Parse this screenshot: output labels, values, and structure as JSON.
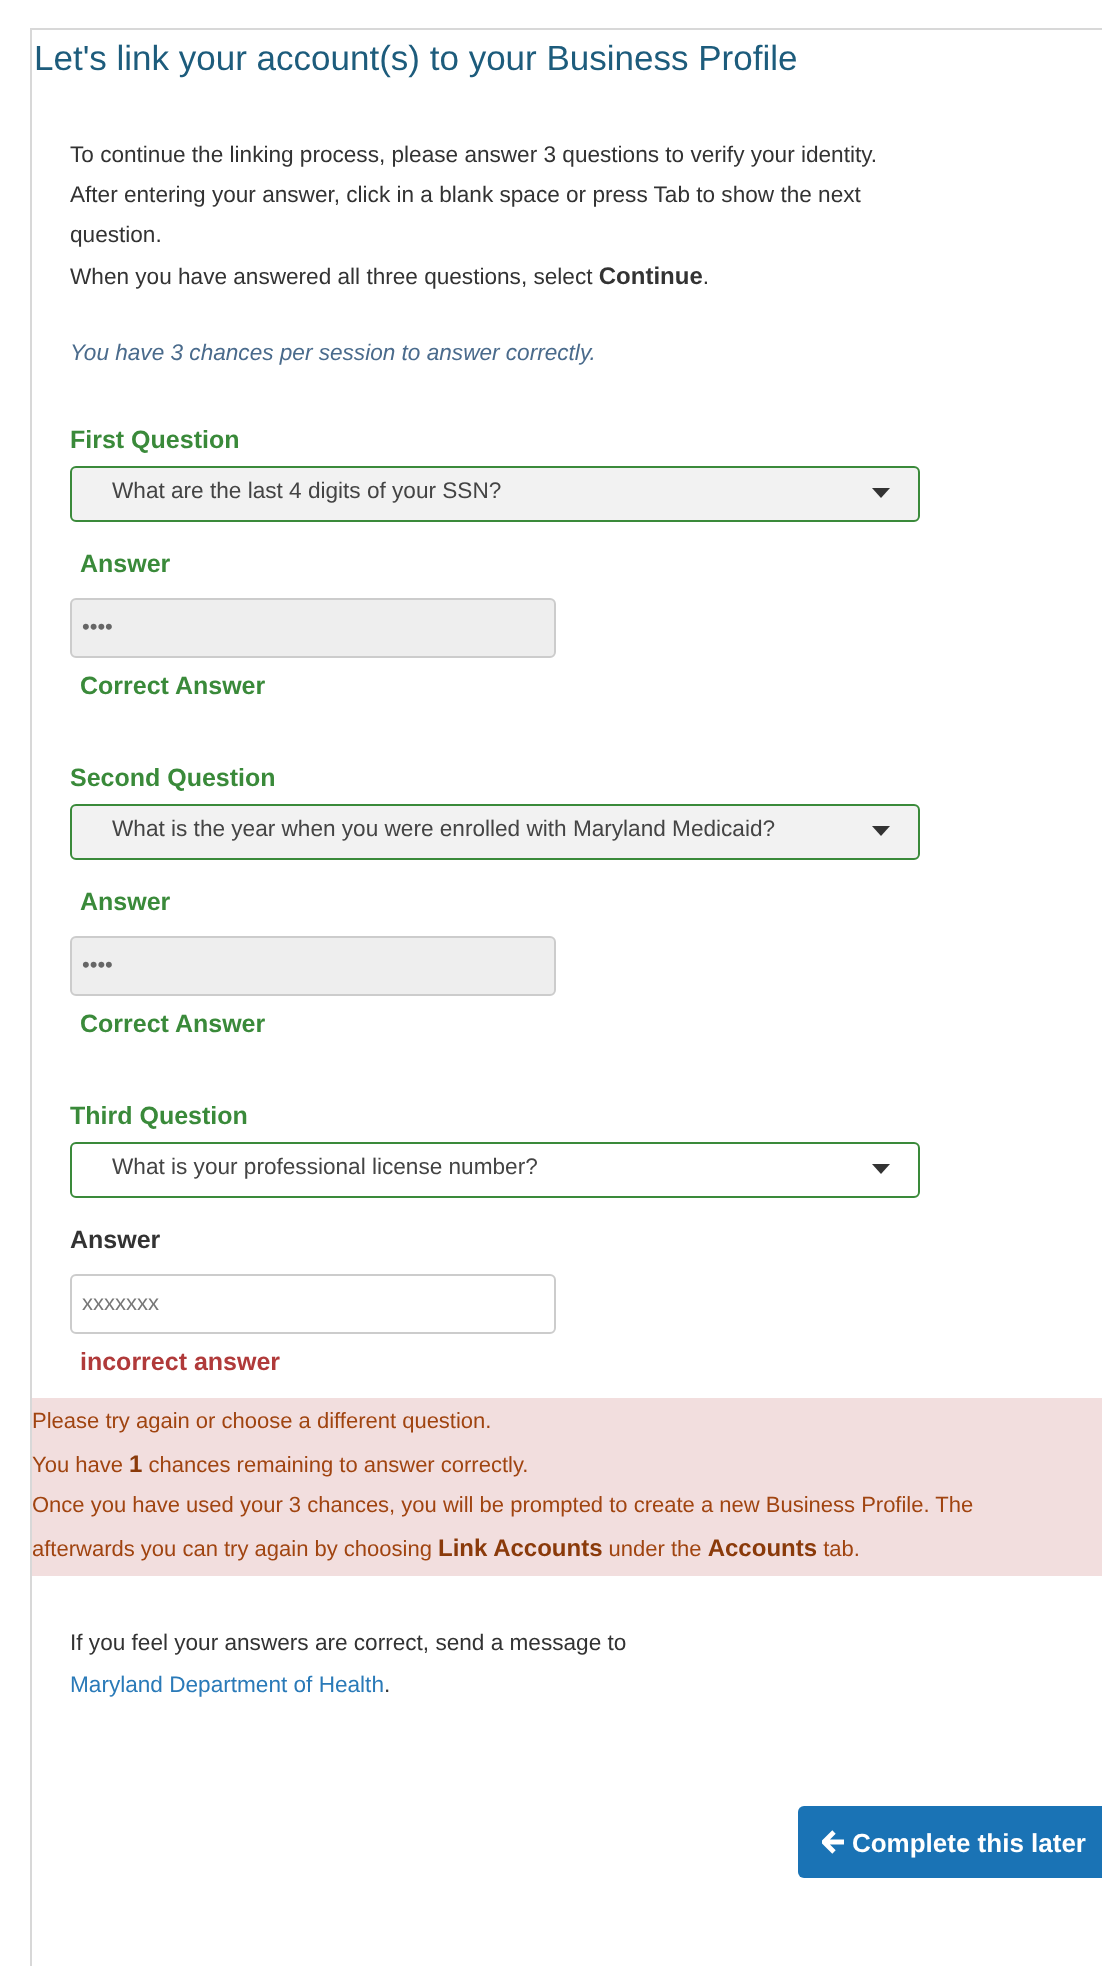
{
  "title": "Let's link your account(s) to your Business Profile",
  "instructions": [
    "To continue the linking process, please answer 3 questions to verify your identity.",
    "After entering your answer, click in a blank space or press Tab to show the next question.",
    "When you have answered all three questions, select **Continue**."
  ],
  "chances_note": "You have 3 chances per session to answer correctly.",
  "questions": [
    {
      "label": "First Question",
      "question": "What are the last 4 digits of your SSN?",
      "answer_label": "Answer",
      "answer": "••••",
      "disabled": true,
      "kind": "correct",
      "message": "Correct Answer"
    },
    {
      "label": "Second Question",
      "question": "What is the year when you were enrolled with Maryland Medicaid?",
      "answer_label": "Answer",
      "answer": "••••",
      "disabled": true,
      "kind": "correct",
      "message": "Correct Answer"
    },
    {
      "label": "Third Question",
      "question": "What is your professional license number?",
      "answer_label": "Answer",
      "answer": "xxxxxxx",
      "disabled": false,
      "kind": "incorrect",
      "message": "incorrect answer"
    }
  ],
  "error_lines": [
    "Please try again or choose a different question.",
    "You have **1** chances remaining to answer correctly.",
    "Once you have used your 3 chances, you will be prompted to create a new Business Profile. The",
    "afterwards you can try again by choosing **Link Accounts** under the **Accounts** tab."
  ],
  "contact": {
    "text": "If you feel your answers are correct, send a message to",
    "link": "Maryland Department of Health",
    "end": "."
  },
  "button": {
    "label": "Complete this later"
  }
}
